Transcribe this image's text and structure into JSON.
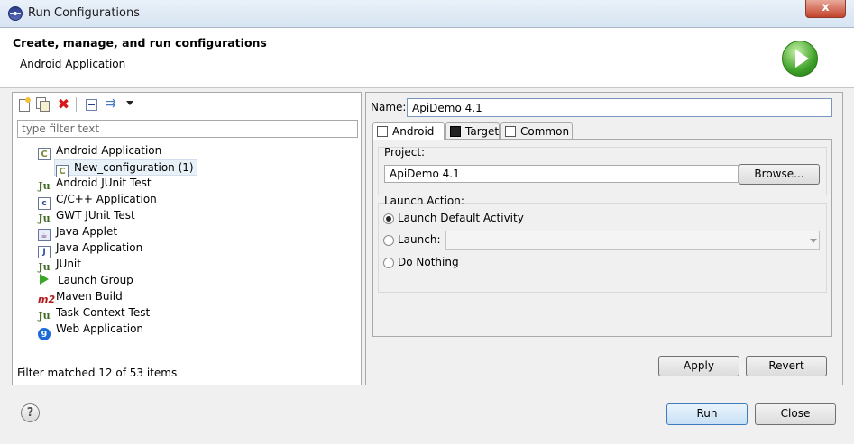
{
  "window": {
    "title": "Run Configurations",
    "close_glyph": "x"
  },
  "header": {
    "heading": "Create, manage, and run configurations",
    "subheading": "Android Application",
    "badge_icon": "run-icon"
  },
  "toolbar": {
    "icons": [
      "new-config-icon",
      "duplicate-icon",
      "delete-icon",
      "collapse-all-icon",
      "filter-icon",
      "dropdown-arrow-icon"
    ],
    "delete_glyph": "✖",
    "filter_glyph": "⇉"
  },
  "filter": {
    "placeholder": "type filter text",
    "status": "Filter matched 12 of 53 items"
  },
  "tree": {
    "items": [
      {
        "label": "Android Application",
        "icon": "android-app-icon",
        "glyph": "C"
      },
      {
        "label": "New_configuration (1)",
        "icon": "android-app-icon",
        "glyph": "C"
      },
      {
        "label": "Android JUnit Test",
        "icon": "junit-icon",
        "glyph": "Ju"
      },
      {
        "label": "C/C++ Application",
        "icon": "c-app-icon",
        "glyph": "c"
      },
      {
        "label": "GWT JUnit Test",
        "icon": "junit-icon",
        "glyph": "Ju"
      },
      {
        "label": "Java Applet",
        "icon": "applet-icon",
        "glyph": "☕"
      },
      {
        "label": "Java Application",
        "icon": "java-app-icon",
        "glyph": "J"
      },
      {
        "label": "JUnit",
        "icon": "junit-icon",
        "glyph": "Ju"
      },
      {
        "label": "Launch Group",
        "icon": "launch-group-icon",
        "glyph": ""
      },
      {
        "label": "Maven Build",
        "icon": "maven-icon",
        "glyph": "m2"
      },
      {
        "label": "Task Context Test",
        "icon": "junit-icon",
        "glyph": "Ju"
      },
      {
        "label": "Web Application",
        "icon": "web-app-icon",
        "glyph": "g"
      }
    ]
  },
  "config": {
    "name_label": "Name:",
    "name_value": "ApiDemo 4.1",
    "tabs": [
      {
        "label": "Android",
        "icon": "android-tab-icon",
        "selected": true
      },
      {
        "label": "Target",
        "icon": "target-tab-icon",
        "selected": false
      },
      {
        "label": "Common",
        "icon": "common-tab-icon",
        "selected": false
      }
    ],
    "project_label": "Project:",
    "project_value": "ApiDemo 4.1",
    "browse_label": "Browse...",
    "launch_action_label": "Launch Action:",
    "options": [
      {
        "label": "Launch Default Activity",
        "selected": true
      },
      {
        "label": "Launch:",
        "selected": false
      },
      {
        "label": "Do Nothing",
        "selected": false
      }
    ],
    "activity_value": "",
    "apply_label": "Apply",
    "revert_label": "Revert"
  },
  "footer": {
    "help_glyph": "?",
    "run_label": "Run",
    "close_label": "Close"
  }
}
